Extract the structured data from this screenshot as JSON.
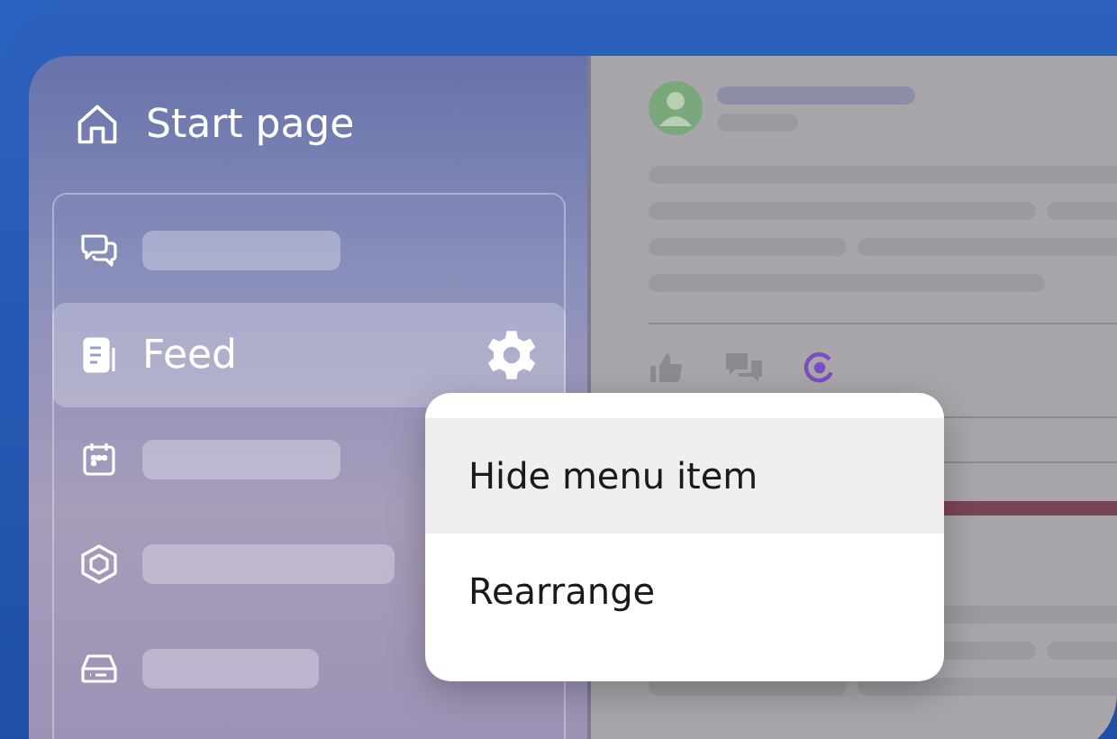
{
  "sidebar": {
    "header": {
      "label": "Start page"
    },
    "items": [
      {
        "selected": false
      },
      {
        "label": "Feed",
        "selected": true
      },
      {
        "selected": false
      },
      {
        "selected": false
      },
      {
        "selected": false
      }
    ]
  },
  "context_menu": {
    "items": [
      {
        "label": "Hide menu item",
        "selected": true
      },
      {
        "label": "Rearrange",
        "selected": false
      }
    ]
  }
}
